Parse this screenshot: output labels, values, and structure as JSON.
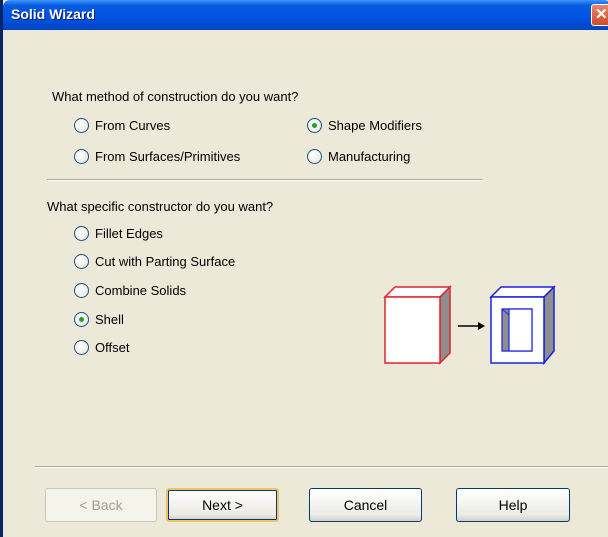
{
  "window": {
    "title": "Solid Wizard"
  },
  "method": {
    "question": "What method of construction do you want?",
    "options": [
      {
        "label": "From Curves",
        "checked": false
      },
      {
        "label": "Shape Modifiers",
        "checked": true
      },
      {
        "label": "From Surfaces/Primitives",
        "checked": false
      },
      {
        "label": "Manufacturing",
        "checked": false
      }
    ]
  },
  "constructor": {
    "question": "What specific constructor do you want?",
    "options": [
      {
        "label": "Fillet Edges",
        "checked": false
      },
      {
        "label": "Cut with Parting Surface",
        "checked": false
      },
      {
        "label": "Combine Solids",
        "checked": false
      },
      {
        "label": "Shell",
        "checked": true
      },
      {
        "label": "Offset",
        "checked": false
      }
    ]
  },
  "preview": {
    "description_icon": "box-to-shell-illustration"
  },
  "buttons": {
    "back": "< Back",
    "next": "Next >",
    "cancel": "Cancel",
    "help": "Help"
  },
  "colors": {
    "titlebar": "#0054E3",
    "dialog_bg": "#ECE9D8",
    "solid_outline": "#E0262C",
    "shell_outline": "#1A22E0"
  }
}
